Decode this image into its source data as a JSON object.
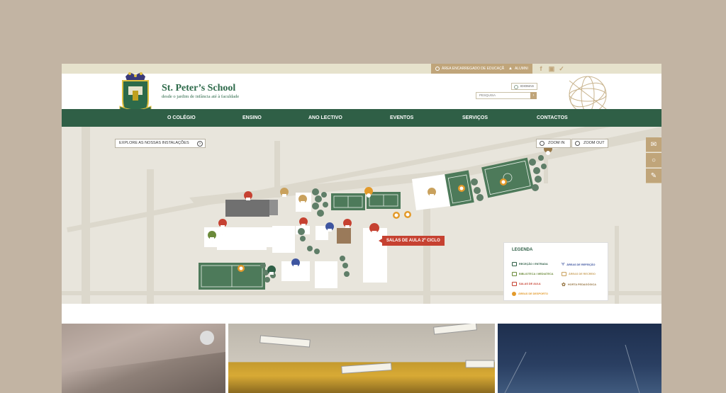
{
  "topbar": {
    "staff_label": "ÁREA ENCARREGADO DE EDUCAÇÃO",
    "alumni_label": "ALUMNI",
    "social": [
      {
        "name": "facebook-icon",
        "glyph": "f"
      },
      {
        "name": "instagram-icon",
        "glyph": "◘"
      },
      {
        "name": "twitter-icon",
        "glyph": "t"
      }
    ]
  },
  "header": {
    "school_name": "St. Peter’s School",
    "tagline": "desde o jardim de infância até à faculdade",
    "idiomas_label": "IDIOMAS",
    "search_placeholder": "PESQUISA"
  },
  "nav": [
    "O COLÉGIO",
    "ENSINO",
    "ANO LECTIVO",
    "EVENTOS",
    "SERVIÇOS",
    "CONTACTOS"
  ],
  "map": {
    "explore_label": "EXPLORE AS NOSSAS INSTALAÇÕES",
    "zoom_in_label": "ZOOM IN",
    "zoom_out_label": "ZOOM OUT",
    "callout": "SALAS DE AULA 2º CICLO",
    "legend_title": "LEGENDA",
    "legend": [
      {
        "label": "RECEÇÃO / ENTRADA",
        "color": "#2f5f46"
      },
      {
        "label": "ÁREAS DE REFEIÇÃO",
        "color": "#3e55a0"
      },
      {
        "label": "BIBLIOTECA / MEDIATECA",
        "color": "#6b8a3a"
      },
      {
        "label": "ÁREAS DE RECREIO",
        "color": "#c9a15d"
      },
      {
        "label": "SALAS DE AULA",
        "color": "#c64131"
      },
      {
        "label": "HORTA PEDAGÓGICA",
        "color": "#9a7a4a"
      },
      {
        "label": "ÁREAS DE DESPORTO",
        "color": "#e39a2a"
      }
    ]
  },
  "colors": {
    "nav": "#2f5f46",
    "gold": "#c0a57a",
    "red": "#c64131",
    "page_bg": "#c2b4a3"
  }
}
